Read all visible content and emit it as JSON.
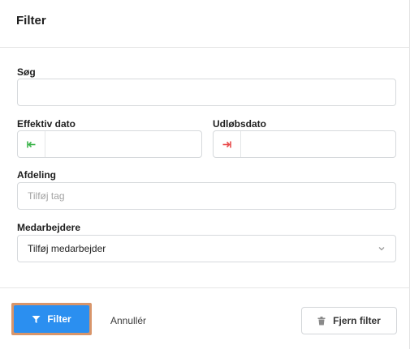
{
  "dialog": {
    "title": "Filter"
  },
  "fields": {
    "search": {
      "label": "Søg",
      "value": ""
    },
    "effective_date": {
      "label": "Effektiv dato",
      "value": "",
      "icon": "arrow-to-left-icon",
      "icon_color": "#3cb44b"
    },
    "expiry_date": {
      "label": "Udløbsdato",
      "value": "",
      "icon": "arrow-to-right-icon",
      "icon_color": "#e84c4c"
    },
    "department": {
      "label": "Afdeling",
      "placeholder": "Tilføj tag"
    },
    "employees": {
      "label": "Medarbejdere",
      "selected": "Tilføj medarbejder"
    }
  },
  "footer": {
    "filter_label": "Filter",
    "cancel_label": "Annullér",
    "remove_label": "Fjern filter",
    "accent_color": "#2b8ff0",
    "highlight_color": "#d8956a"
  }
}
